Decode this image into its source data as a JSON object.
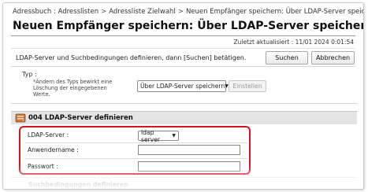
{
  "breadcrumb": [
    "Adressbuch : Adresslisten",
    "Adressliste Zielwahl",
    "Neuen Empfänger speichern: Über LDAP-Server speichern"
  ],
  "breadcrumb_separator": ">",
  "page_title": "Neuen Empfänger speichern: Über LDAP-Server speichern",
  "last_updated": "Zuletzt aktualisiert : 11/01 2024 0:01:54",
  "instruction": "LDAP-Server und Suchbedingungen definieren, dann [Suchen] betätigen.",
  "buttons": {
    "search": "Suchen",
    "cancel": "Abbrechen",
    "set": "Einstellen"
  },
  "type": {
    "label": "Typ :",
    "note": "*Ändern des Typs bewirkt eine Löschung der eingegebenen Werte.",
    "selected": "Über LDAP-Server speichern"
  },
  "section": {
    "title": "004 LDAP-Server definieren",
    "icon": "server-icon"
  },
  "fields": {
    "server_label": "LDAP-Server :",
    "server_value": "ldap server",
    "username_label": "Anwendername :",
    "password_label": "Passwort :"
  },
  "subsection_title": "Suchbedingungen definieren",
  "colors": {
    "highlight": "#d4141c",
    "section_bg": "#e4e4e4"
  }
}
